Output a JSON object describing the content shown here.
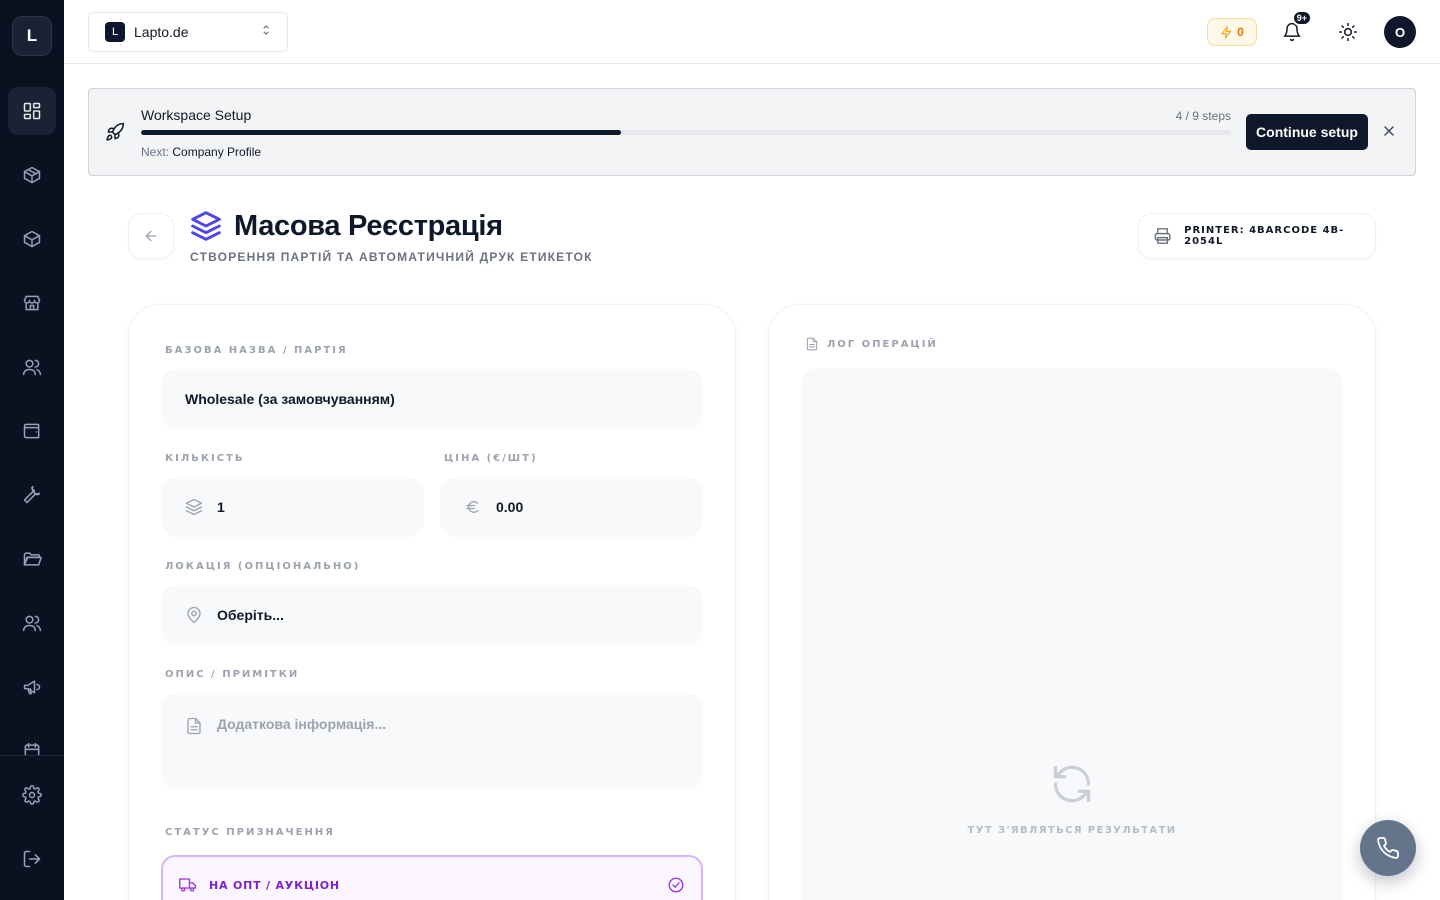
{
  "sidebar": {
    "logo_letter": "L",
    "items": [
      {
        "icon": "dashboard-icon",
        "active": true
      },
      {
        "icon": "package-icon"
      },
      {
        "icon": "box-icon"
      },
      {
        "icon": "store-icon"
      },
      {
        "icon": "users-icon"
      },
      {
        "icon": "wallet-icon"
      },
      {
        "icon": "wrench-icon"
      },
      {
        "icon": "folder-icon"
      },
      {
        "icon": "team-icon"
      },
      {
        "icon": "megaphone-icon"
      }
    ],
    "bottom_items": [
      {
        "icon": "settings-icon"
      },
      {
        "icon": "logout-icon"
      }
    ]
  },
  "topbar": {
    "workspace_badge": "L",
    "workspace_name": "Lapto.de",
    "credits": "0",
    "notifications_badge": "9+",
    "avatar_letter": "O"
  },
  "setup": {
    "title": "Workspace Setup",
    "steps": "4 / 9 steps",
    "progress": 0.44,
    "next_label": "Next:",
    "next_value": "Company Profile",
    "button": "Continue setup"
  },
  "header": {
    "title": "Масова Реєстрація",
    "subtitle": "СТВОРЕННЯ ПАРТІЙ ТА АВТОМАТИЧНИЙ ДРУК ЕТИКЕТОК",
    "printer": "PRINTER: 4BARCODE 4B-2054L"
  },
  "form": {
    "base_name_label": "БАЗОВА НАЗВА / ПАРТІЯ",
    "base_name_value": "Wholesale (за замовчуванням)",
    "quantity_label": "КІЛЬКІСТЬ",
    "quantity_value": "1",
    "price_label": "ЦІНА (€/ШТ)",
    "price_value": "0.00",
    "location_label": "ЛОКАЦІЯ (ОПЦІОНАЛЬНО)",
    "location_value": "Оберіть...",
    "notes_label": "ОПИС / ПРИМІТКИ",
    "notes_placeholder": "Додаткова інформація...",
    "status_label": "СТАТУС ПРИЗНАЧЕННЯ",
    "status_option": "НА ОПТ / АУКЦІОН"
  },
  "log": {
    "label": "ЛОГ ОПЕРАЦІЙ",
    "empty_text": "ТУТ З'ЯВЛЯТЬСЯ РЕЗУЛЬТАТИ"
  },
  "colors": {
    "sidebar_bg": "#0b1120",
    "accent": "#4f46e5",
    "status_accent": "#9333ea",
    "primary_button": "#0f172a"
  }
}
